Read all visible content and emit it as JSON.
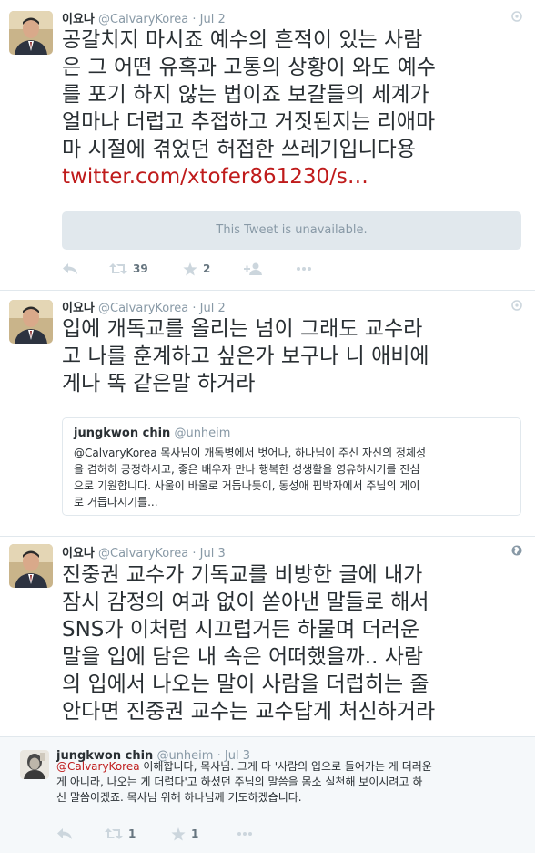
{
  "tweets": [
    {
      "name": "이요나",
      "handle": "@CalvaryKorea",
      "dot": "·",
      "date": "Jul 2",
      "lines": [
        "공갈치지 마시죠 예수의 흔적이 있는 사람",
        "은 그 어떤 유혹과 고통의 상황이 와도 예수",
        "를 포기 하지 않는 법이죠 보갈들의 세계가",
        "얼마나 더럽고 추접하고 거짓된지는 리애마",
        "마 시절에 겪었던 허접한 쓰레기입니다용"
      ],
      "link": "twitter.com/xtofer861230/s…",
      "unavailable": "This Tweet is unavailable.",
      "retweets": "39",
      "favorites": "2"
    },
    {
      "name": "이요나",
      "handle": "@CalvaryKorea",
      "dot": "·",
      "date": "Jul 2",
      "lines": [
        "입에 개독교를 올리는 넘이 그래도 교수라",
        "고 나를 훈계하고 싶은가 보구나 니 애비에",
        "게나 똑 같은말 하거라"
      ],
      "quote": {
        "name": "jungkwon chin",
        "handle": "@unheim",
        "lines": [
          "@CalvaryKorea 목사님이 개독병에서 벗어나, 하나님이 주신 자신의 정체성",
          "을 겸허히 긍정하시고, 좋은 배우자 만나 행복한 성생활을 영유하시기를 진심",
          "으로 기원합니다. 사울이 바울로 거듭나듯이, 동성애 핍박자에서 주님의 게이",
          "로 거듭나시기를..."
        ]
      }
    },
    {
      "name": "이요나",
      "handle": "@CalvaryKorea",
      "dot": "·",
      "date": "Jul 3",
      "lines": [
        "진중권 교수가 기독교를 비방한 글에 내가",
        "잠시 감정의 여과 없이 쏟아낸 말들로 해서",
        "SNS가 이처럼 시끄럽거든 하물며 더러운",
        "말을 입에 담은 내 속은 어떠했을까.. 사람",
        "의 입에서 나오는 말이 사람을 더럽히는 줄",
        "안다면 진중권 교수는 교수답게 처신하거라"
      ]
    }
  ],
  "reply": {
    "name": "jungkwon chin",
    "handle": "@unheim",
    "dot": "·",
    "date": "Jul 3",
    "mention": "@CalvaryKorea",
    "first_line_rest": " 이해합니다, 목사님. 그게 다 '사람의 입으로 들어가는 게 더러운",
    "lines": [
      "게 아니라, 나오는 게 더럽다'고 하셨던 주님의 말씀을 몸소 실천해 보이시려고 하",
      "신 말씀이겠죠. 목사님 위해 하나님께 기도하겠습니다."
    ],
    "retweets": "1",
    "favorites": "1"
  },
  "icons": {
    "reply": "reply-icon",
    "retweet": "retweet-icon",
    "favorite": "star-icon",
    "follow": "follow-icon",
    "more": "more-icon",
    "conversation": "conversation-icon",
    "globe": "globe-icon"
  },
  "colors": {
    "link": "#bf1b1b",
    "meta": "#8899a6",
    "text": "#292f33",
    "divider": "#e1e8ed",
    "reply_bg": "#f5f8fa"
  }
}
